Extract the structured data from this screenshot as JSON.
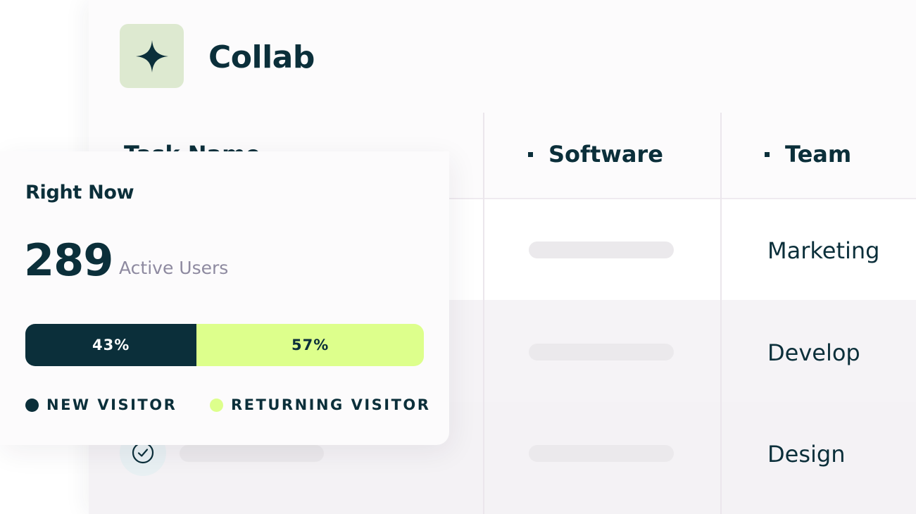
{
  "brand": {
    "name": "Collab",
    "logo_icon": "sparkle-icon",
    "logo_bg": "#dde9d0"
  },
  "table": {
    "columns": [
      "Task Name",
      "Software",
      "Team"
    ],
    "rows": [
      {
        "team": "Marketing"
      },
      {
        "team": "Develop"
      },
      {
        "team": "Design"
      }
    ],
    "row_status_icon": "check-circle-icon"
  },
  "stats": {
    "title": "Right Now",
    "count": "289",
    "count_label": "Active Users",
    "new_visitor": {
      "label": "NEW VISITOR",
      "percent_text": "43%",
      "percent": 43,
      "color": "#0b2f3a"
    },
    "returning_visitor": {
      "label": "RETURNING VISITOR",
      "percent_text": "57%",
      "percent": 57,
      "color": "#ddff8c"
    }
  }
}
